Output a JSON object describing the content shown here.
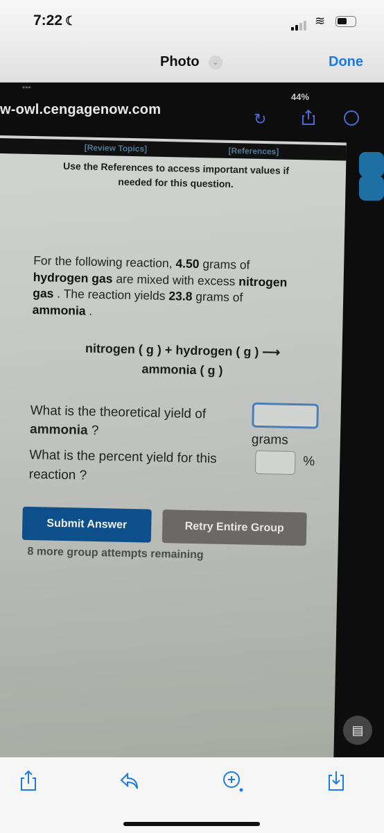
{
  "status_bar": {
    "time": "7:22",
    "focus_icon": "moon-icon"
  },
  "nav": {
    "title": "Photo",
    "done_label": "Done"
  },
  "photo": {
    "url": "w-owl.cengagenow.com",
    "ipad_status": "44%",
    "links": {
      "review_topics": "[Review Topics]",
      "references": "[References]"
    },
    "instruction": "Use the References to access important values if needed for this question.",
    "question": {
      "p1": "For the following reaction, ",
      "mass_h2": "4.50",
      "p2": " grams of ",
      "h2": "hydrogen gas",
      "p3": " are mixed with excess ",
      "n2": "nitrogen gas",
      "p4": " . The reaction yields ",
      "yield_mass": "23.8",
      "p5": " grams of ",
      "nh3": "ammonia",
      "p6": " ."
    },
    "equation": {
      "line1": "nitrogen ( g ) + hydrogen ( g ) ⟶",
      "line2": "ammonia ( g )"
    },
    "q_theoretical": {
      "pre": "What is the theoretical yield of ",
      "bold": "ammonia",
      "post": " ?",
      "value": "",
      "unit": "grams"
    },
    "q_percent": {
      "text": "What is the percent yield for this reaction ?",
      "value": "",
      "unit": "%"
    },
    "submit_label": "Submit Answer",
    "retry_label": "Retry Entire Group",
    "attempts": "8 more group attempts remaining"
  },
  "toolbar": {
    "icons": [
      "share-icon",
      "markup-icon",
      "zoom-icon",
      "save-icon"
    ]
  }
}
